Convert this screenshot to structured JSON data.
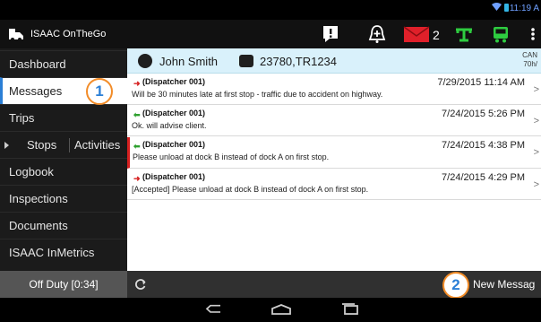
{
  "status_bar": {
    "time": "11:19 A"
  },
  "app_bar": {
    "title": "ISAAC OnTheGo",
    "icons": [
      "alert-icon",
      "bell-icon",
      "mail-icon",
      "hos-icon",
      "truck-icon",
      "overflow-icon"
    ],
    "unread_count": "2",
    "colors": {
      "mail": "#e0202a",
      "green": "#2ecc40"
    }
  },
  "sidebar": {
    "items": [
      {
        "label": "Dashboard"
      },
      {
        "label": "Messages"
      },
      {
        "label": "Trips"
      },
      {
        "label_a": "Stops",
        "label_b": "Activities"
      },
      {
        "label": "Logbook"
      },
      {
        "label": "Inspections"
      },
      {
        "label": "Documents"
      },
      {
        "label": "ISAAC InMetrics"
      }
    ]
  },
  "callouts": [
    "1",
    "2"
  ],
  "contact": {
    "name": "John Smith",
    "vehicle": "23780,TR1234",
    "cam_line1": "CAN",
    "cam_line2": "70h/"
  },
  "messages": [
    {
      "sender": "(Dispatcher 001)",
      "date": "7/29/2015 11:14 AM",
      "body": "Will be 30 minutes late at first stop - traffic due to accident on highway.",
      "direction": "outgoing"
    },
    {
      "sender": "(Dispatcher 001)",
      "date": "7/24/2015 5:26 PM",
      "body": "Ok. will advise client.",
      "direction": "incoming"
    },
    {
      "sender": "(Dispatcher 001)",
      "date": "7/24/2015 4:38 PM",
      "body": "Please unload at dock B instead of dock A on first stop.",
      "direction": "incoming"
    },
    {
      "sender": "(Dispatcher 001)",
      "date": "7/24/2015 4:29 PM",
      "body": "[Accepted] Please unload at dock B instead of dock A on first stop.",
      "direction": "outgoing"
    }
  ],
  "bottom_bar": {
    "duty_status": "Off Duty [0:34]",
    "new_message_label": "New Messag"
  }
}
